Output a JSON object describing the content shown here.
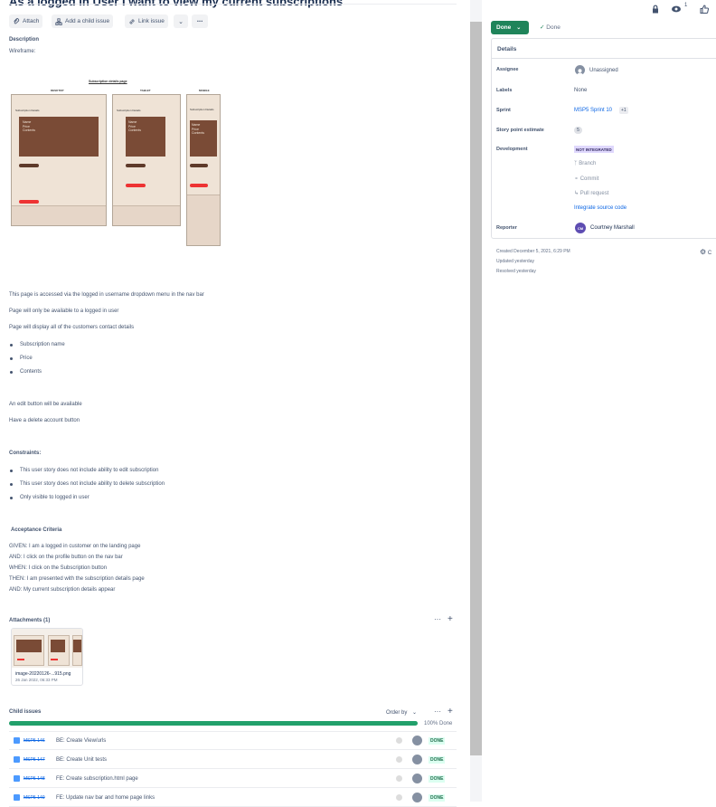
{
  "issue": {
    "title": "As a logged in User I want to view my current subscriptions"
  },
  "toolbar": {
    "attach": "Attach",
    "add_child": "Add a child issue",
    "link_issue": "Link issue"
  },
  "description": {
    "heading": "Description",
    "wireframe_label": "Wireframe:",
    "wireframe": {
      "title": "Subscription details page",
      "desktop": "DESKTOP",
      "tablet": "TABLET",
      "mobile": "MOBILE",
      "section": "Subscription Details",
      "lines": [
        "Name",
        "Price",
        "Contents"
      ]
    },
    "para1": "This page is accessed via the logged in username dropdown menu in the nav bar",
    "para2": "Page will only be available to a logged in user",
    "para3": "Page will display all of the customers contact details",
    "bullets1": [
      "Subscription name",
      "Price",
      "Contents"
    ],
    "para4": "An edit button will be available",
    "para5": "Have a delete account button",
    "constraints_heading": "Constraints:",
    "constraints": [
      "This user story does not include ability to edit subscription",
      "This user story does not include ability to delete subscription",
      "Only visible to logged in user"
    ],
    "ac_heading": "Acceptance Criteria",
    "ac": [
      "GIVEN: I am a logged in customer on the landing page",
      "AND: I click on the profile button on the nav bar",
      "WHEN: I click on the Subscription button",
      "THEN: I am presented with the subscription details page",
      "AND: My current subscription details appear"
    ]
  },
  "attachments": {
    "heading": "Attachments (1)",
    "file_name": "image-20220126-...915.png",
    "file_date": "26 Jan 2022, 06:33 PM"
  },
  "child_issues": {
    "heading": "Child issues",
    "order_by": "Order by",
    "progress_pct": 100,
    "progress_label": "100% Done",
    "rows": [
      {
        "key": "MSP5-146",
        "summary": "BE: Create View/urls",
        "status": "DONE"
      },
      {
        "key": "MSP5-147",
        "summary": "BE: Create Unit tests",
        "status": "DONE"
      },
      {
        "key": "MSP5-148",
        "summary": "FE: Create subscription.html page",
        "status": "DONE"
      },
      {
        "key": "MSP5-149",
        "summary": "FE: Update nav bar and home page links",
        "status": "DONE"
      }
    ]
  },
  "header_right": {
    "watchers": "1"
  },
  "status": {
    "button": "Done",
    "resolution": "Done"
  },
  "details": {
    "heading": "Details",
    "assignee_label": "Assignee",
    "assignee": "Unassigned",
    "labels_label": "Labels",
    "labels": "None",
    "sprint_label": "Sprint",
    "sprint": "MSP5 Sprint 10",
    "sprint_more": "+1",
    "estimate_label": "Story point estimate",
    "estimate": "5",
    "development_label": "Development",
    "development_status": "NOT INTEGRATED",
    "branch": "Branch",
    "commit": "Commit",
    "pull_request": "Pull request",
    "integrate": "Integrate source code",
    "reporter_label": "Reporter",
    "reporter": "Courtney Marshall",
    "reporter_initials": "CM"
  },
  "meta": {
    "created": "Created December 5, 2021, 6:29 PM",
    "updated": "Updated yesterday",
    "resolved": "Resolved yesterday",
    "configure": "C"
  },
  "colors": {
    "primary_green": "#1f845a",
    "link": "#0c66e4",
    "progress": "#22a06b"
  }
}
